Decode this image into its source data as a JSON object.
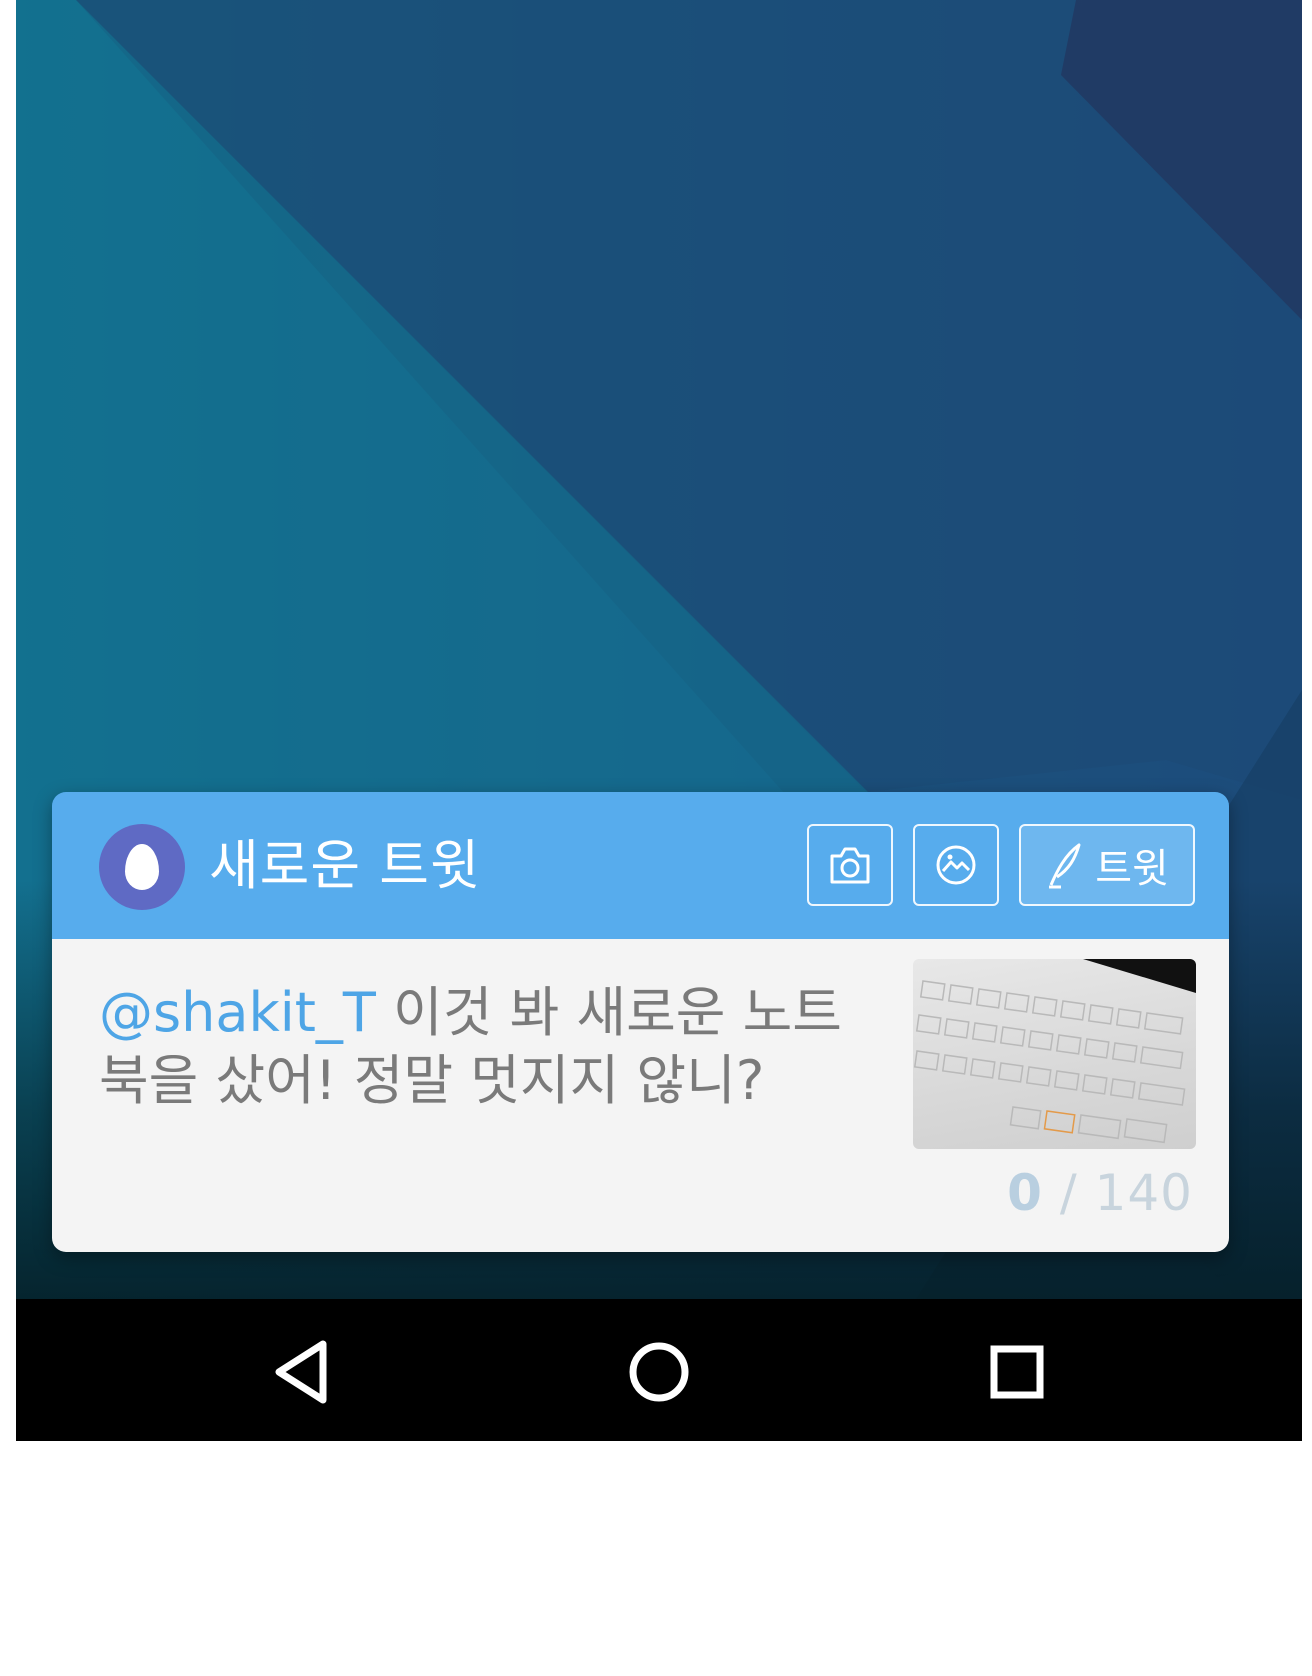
{
  "widget": {
    "title": "새로운 트윗",
    "tweet_button_label": "트윗",
    "mention": "@shakit_T",
    "body_text": " 이것 봐 새로운 노트북을 샀어! 정말 멋지지 않니?",
    "char_count": "0",
    "char_separator": " / ",
    "char_limit": "140"
  },
  "icons": {
    "avatar": "egg-avatar-icon",
    "camera": "camera-icon",
    "gallery": "image-gallery-icon",
    "compose": "quill-pen-icon",
    "nav_back": "back-triangle-icon",
    "nav_home": "home-circle-icon",
    "nav_recents": "recents-square-icon"
  },
  "colors": {
    "header": "#57aced",
    "mention": "#4ea5e6",
    "avatar": "#5f6ac4"
  }
}
